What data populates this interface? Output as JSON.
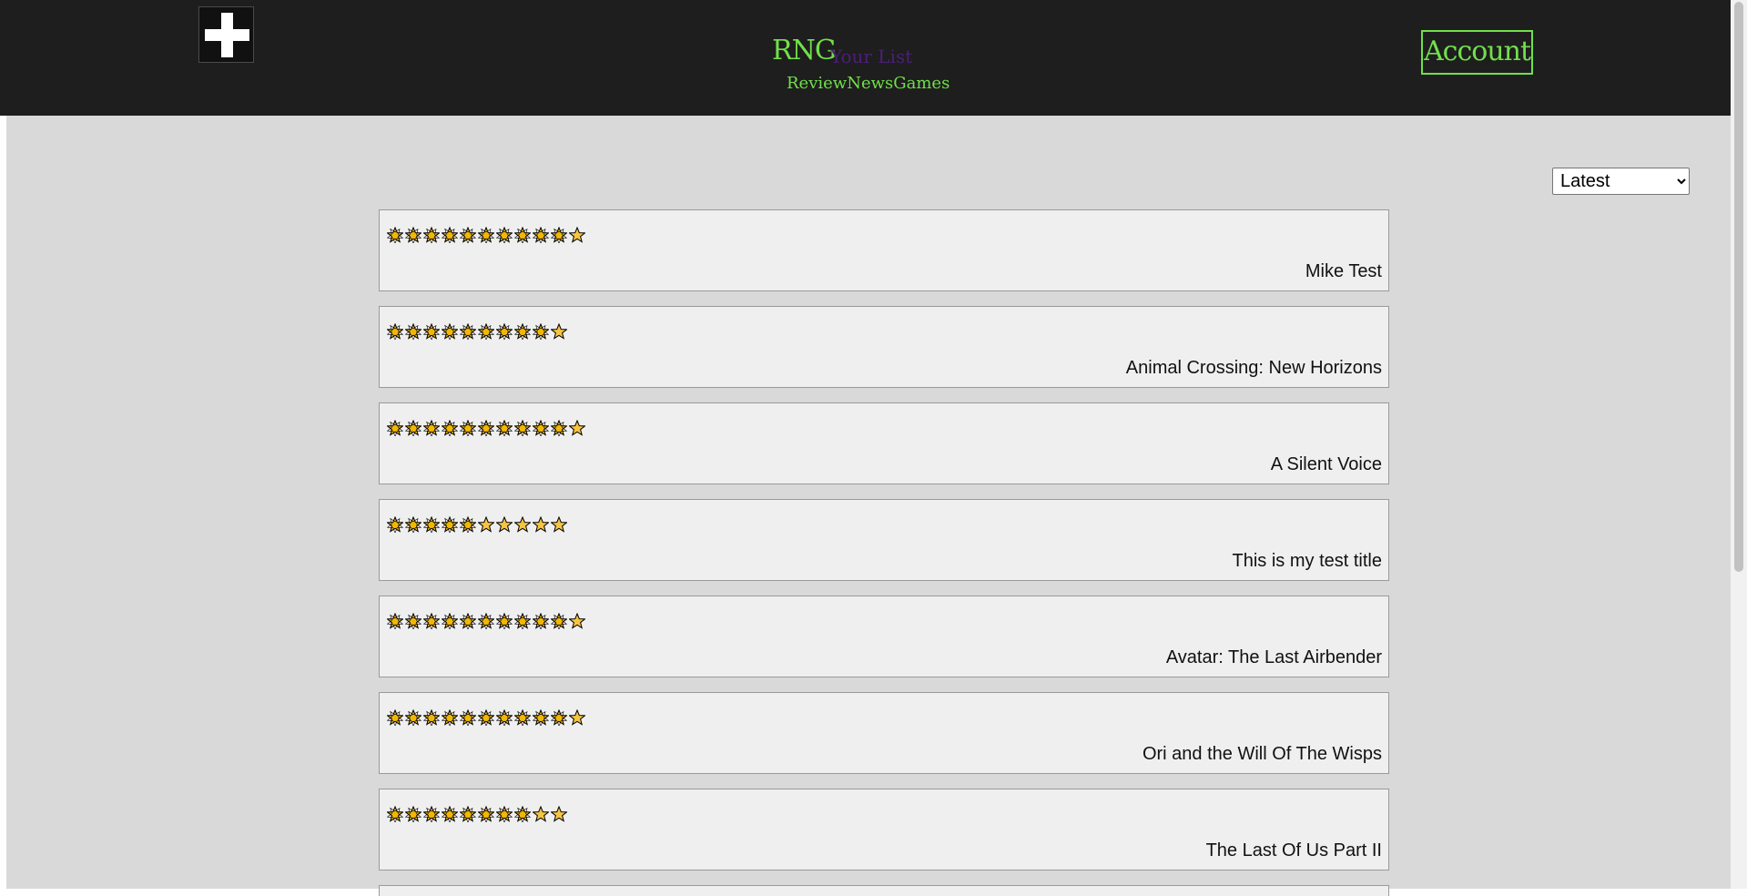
{
  "header": {
    "logo_text": "RNG",
    "your_list_label": "Your List",
    "nav": [
      "Review",
      "News",
      "Games"
    ],
    "account_label": "Account",
    "add_icon": "plus-icon"
  },
  "sort": {
    "selected": "Latest"
  },
  "reviews": [
    {
      "title": "Mike Test",
      "rating": 10,
      "max_rating": 10
    },
    {
      "title": "Animal Crossing: New Horizons",
      "rating": 9,
      "max_rating": 10
    },
    {
      "title": "A Silent Voice",
      "rating": 10,
      "max_rating": 10
    },
    {
      "title": "This is my test title",
      "rating": 5,
      "max_rating": 10
    },
    {
      "title": "Avatar: The Last Airbender",
      "rating": 10,
      "max_rating": 10
    },
    {
      "title": "Ori and the Will Of The Wisps",
      "rating": 10,
      "max_rating": 10
    },
    {
      "title": "The Last Of Us Part II",
      "rating": 8,
      "max_rating": 10
    }
  ],
  "colors": {
    "header_bg": "#1e1e1e",
    "accent_green": "#71e04a",
    "accent_purple": "#4b1f78",
    "page_bg": "#d9d9d9",
    "card_bg": "#efefef",
    "star_filled": "#f2b705",
    "star_empty": "#f5c542"
  }
}
